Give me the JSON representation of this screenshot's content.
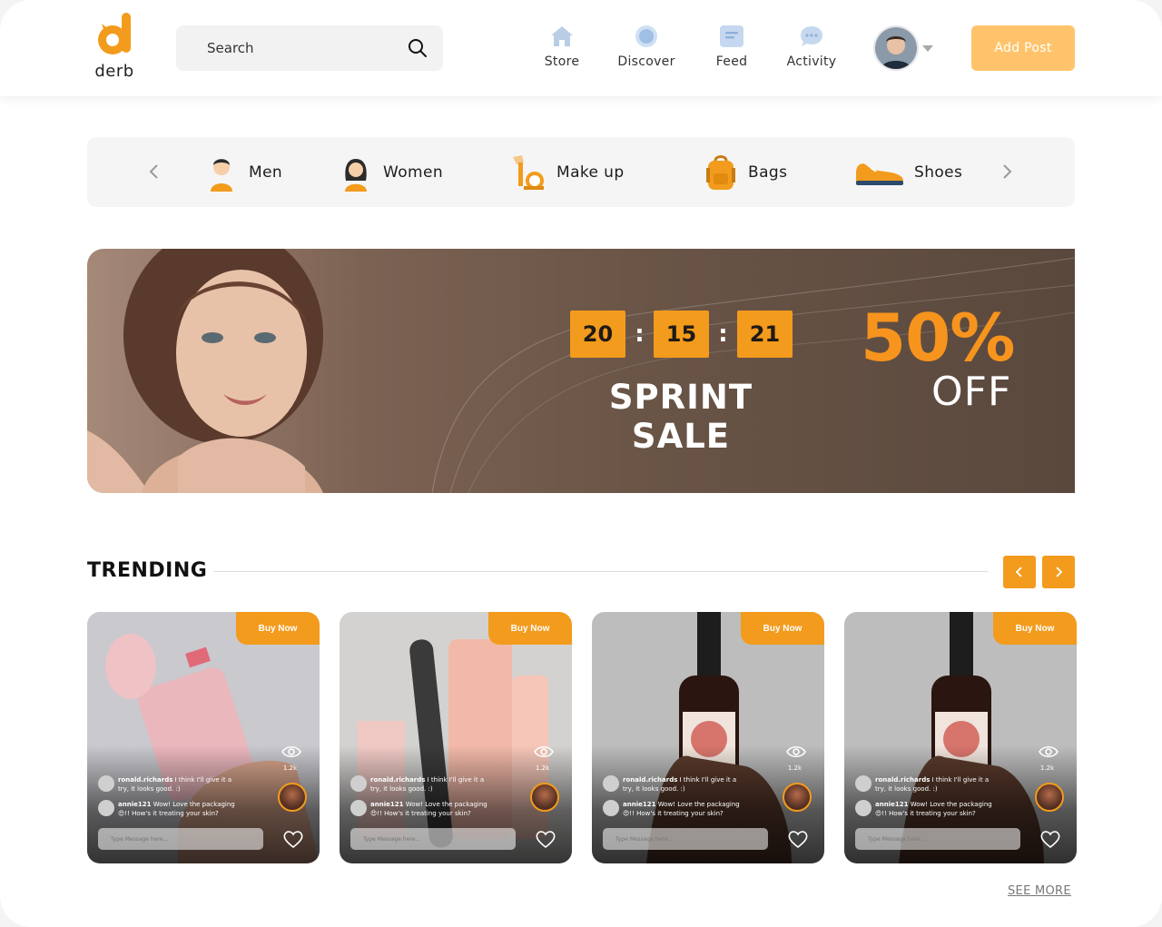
{
  "brand": {
    "name": "derb",
    "accent": "#f39b1c"
  },
  "search": {
    "placeholder": "Search"
  },
  "nav": [
    {
      "label": "Store",
      "icon": "store-icon"
    },
    {
      "label": "Discover",
      "icon": "discover-icon"
    },
    {
      "label": "Feed",
      "icon": "feed-icon"
    },
    {
      "label": "Activity",
      "icon": "activity-icon"
    }
  ],
  "header": {
    "add_post_label": "Add Post"
  },
  "categories": [
    {
      "label": "Men",
      "icon": "man-icon"
    },
    {
      "label": "Women",
      "icon": "woman-icon"
    },
    {
      "label": "Make up",
      "icon": "makeup-icon"
    },
    {
      "label": "Bags",
      "icon": "bag-icon"
    },
    {
      "label": "Shoes",
      "icon": "shoe-icon"
    }
  ],
  "banner": {
    "timer": {
      "hours": "20",
      "minutes": "15",
      "seconds": "21"
    },
    "colon": ":",
    "title": "SPRINT SALE",
    "discount": "50%",
    "discount_suffix": "OFF"
  },
  "trending": {
    "title": "TRENDING",
    "see_more": "SEE MORE",
    "cards": [
      {
        "buy_label": "Buy Now",
        "views": "1.2k",
        "comment1_user": "ronald.richards",
        "comment1_text": "I think I'll give it a try, it looks good. :)",
        "comment2_user": "annie121",
        "comment2_text": "Wow! Love the packaging 😍!! How's it treating your skin?",
        "message_placeholder": "Type Message here..."
      },
      {
        "buy_label": "Buy Now",
        "views": "1.2k",
        "comment1_user": "ronald.richards",
        "comment1_text": "I think I'll give it a try, it looks good. :)",
        "comment2_user": "annie121",
        "comment2_text": "Wow! Love the packaging 😍!! How's it treating your skin?",
        "message_placeholder": "Type Message here..."
      },
      {
        "buy_label": "Buy Now",
        "views": "1.2k",
        "comment1_user": "ronald.richards",
        "comment1_text": "I think I'll give it a try, it looks good. :)",
        "comment2_user": "annie121",
        "comment2_text": "Wow! Love the packaging 😍!! How's it treating your skin?",
        "message_placeholder": "Type Message here..."
      },
      {
        "buy_label": "Buy Now",
        "views": "1.2k",
        "comment1_user": "ronald.richards",
        "comment1_text": "I think I'll give it a try, it looks good. :)",
        "comment2_user": "annie121",
        "comment2_text": "Wow! Love the packaging 😍!! How's it treating your skin?",
        "message_placeholder": "Type Message here..."
      }
    ]
  }
}
